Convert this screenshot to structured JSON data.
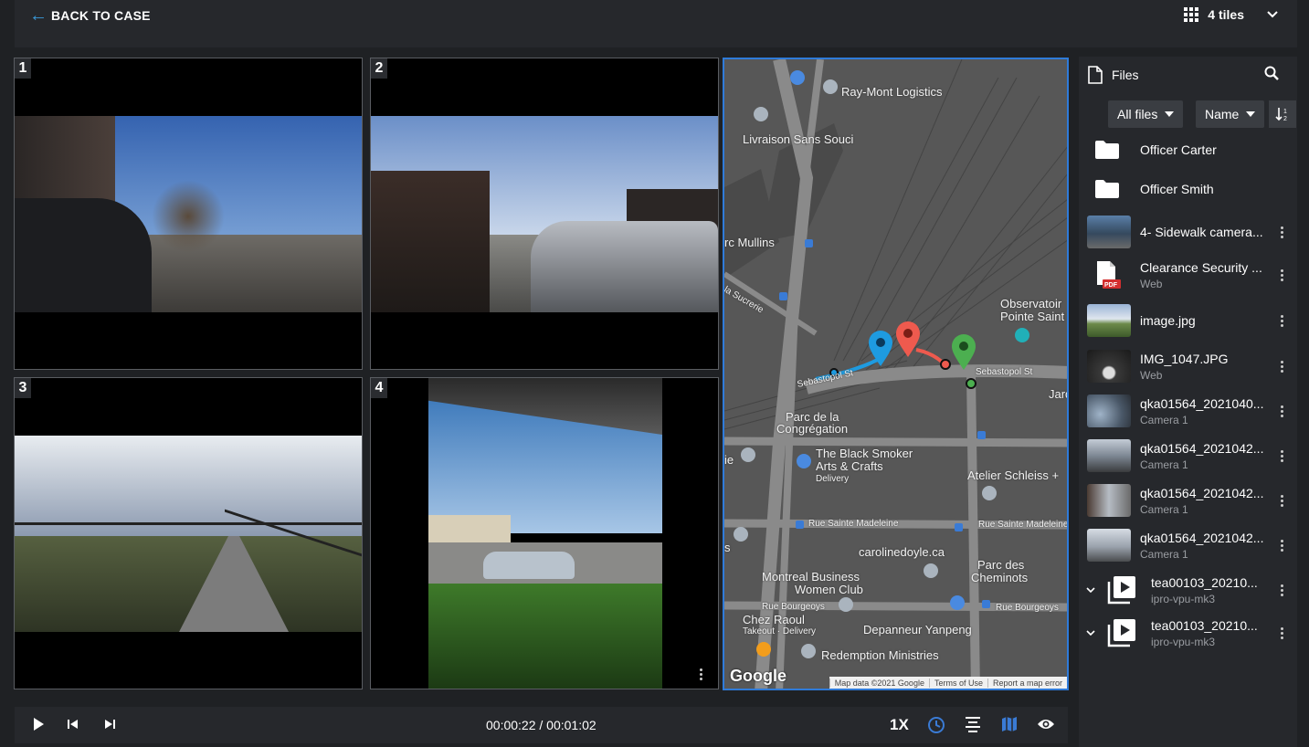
{
  "header": {
    "back_label": "BACK TO CASE",
    "tiles_label": "4 tiles"
  },
  "tiles": [
    {
      "number": "1"
    },
    {
      "number": "2"
    },
    {
      "number": "3"
    },
    {
      "number": "4"
    }
  ],
  "map": {
    "labels": {
      "raymont": "Ray-Mont Logistics",
      "livraison": "Livraison Sans Souci",
      "parc_mullins": "rc Mullins",
      "sucrerie": "la Sucrerie",
      "observatoire1": "Observatoir",
      "observatoire2": "Pointe Saint",
      "sebastopol1": "Sebastopol St",
      "sebastopol2": "Sebastopol St",
      "jar": "Jard",
      "parc_congregation1": "Parc de la",
      "parc_congregation2": "Congrégation",
      "black_smoker1": "The Black Smoker",
      "black_smoker2": "Arts & Crafts",
      "black_smoker_sub": "Delivery",
      "ie": "ie",
      "atelier": "Atelier Schleiss +",
      "rue_madeleine1": "Rue Sainte Madeleine",
      "rue_madeleine2": "Rue Sainte Madeleine",
      "s_label": "s",
      "carolinedoyle": "carolinedoyle.ca",
      "parc_cheminots1": "Parc des",
      "parc_cheminots2": "Cheminots",
      "montreal_business1": "Montreal Business",
      "montreal_business2": "Women Club",
      "rue_bourgeoys1": "Rue Bourgeoys",
      "rue_bourgeoys2": "Rue Bourgeoys",
      "chez_raoul": "Chez Raoul",
      "chez_raoul_sub": "Takeout · Delivery",
      "depanneur": "Depanneur Yanpeng",
      "redemption": "Redemption Ministries"
    },
    "google": "Google",
    "footer": [
      "Map data ©2021 Google",
      "Terms of Use",
      "Report a map error"
    ],
    "colors": {
      "track_blue": "#1e9be0",
      "track_red": "#ee5a4e",
      "pin_green": "#4caf50",
      "road": "#8a8a8a"
    }
  },
  "controls": {
    "time": "00:00:22 / 00:01:02",
    "speed": "1X"
  },
  "sidebar": {
    "title": "Files",
    "filter_label": "All files",
    "sort_label": "Name",
    "items": [
      {
        "title": "Officer Carter",
        "sub": "",
        "icon": "folder-icon"
      },
      {
        "title": "Officer Smith",
        "sub": "",
        "icon": "folder-icon"
      },
      {
        "title": "4- Sidewalk camera...",
        "sub": "",
        "icon": "thumbnail"
      },
      {
        "title": "Clearance Security ...",
        "sub": "Web",
        "icon": "pdf-icon"
      },
      {
        "title": "image.jpg",
        "sub": "",
        "icon": "thumbnail"
      },
      {
        "title": "IMG_1047.JPG",
        "sub": "Web",
        "icon": "thumbnail"
      },
      {
        "title": "qka01564_2021040...",
        "sub": "Camera 1",
        "icon": "thumbnail"
      },
      {
        "title": "qka01564_2021042...",
        "sub": "Camera 1",
        "icon": "thumbnail"
      },
      {
        "title": "qka01564_2021042...",
        "sub": "Camera 1",
        "icon": "thumbnail"
      },
      {
        "title": "qka01564_2021042...",
        "sub": "Camera 1",
        "icon": "thumbnail"
      },
      {
        "title": "tea00103_20210...",
        "sub": "ipro-vpu-mk3",
        "icon": "video-icon"
      },
      {
        "title": "tea00103_20210...",
        "sub": "ipro-vpu-mk3",
        "icon": "video-icon"
      }
    ]
  }
}
